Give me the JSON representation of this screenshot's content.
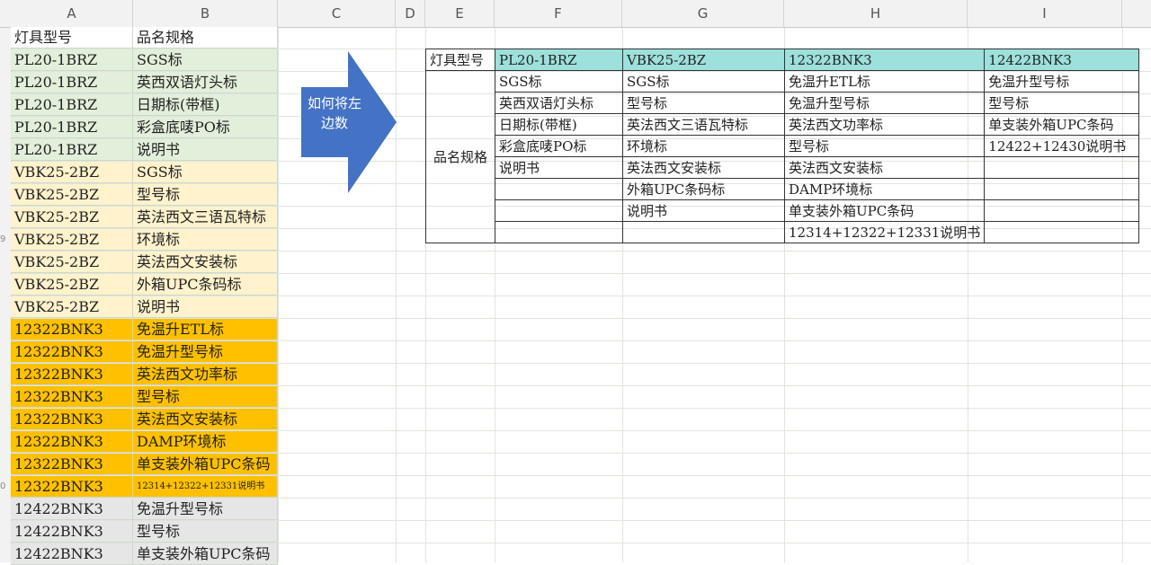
{
  "columns": [
    "A",
    "B",
    "C",
    "D",
    "E",
    "F",
    "G",
    "H",
    "I"
  ],
  "colors": {
    "green": "#e2efda",
    "yellow": "#fff2cc",
    "orange": "#ffc000",
    "gray": "#e7e6e6",
    "teal": "#9de0dc",
    "arrow": "#4472c4"
  },
  "left_header": {
    "model": "灯具型号",
    "spec": "品名规格"
  },
  "left_rows": [
    {
      "model": "PL20-1BRZ",
      "spec": "SGS标",
      "group": "green"
    },
    {
      "model": "PL20-1BRZ",
      "spec": "英西双语灯头标",
      "group": "green"
    },
    {
      "model": "PL20-1BRZ",
      "spec": "日期标(带框)",
      "group": "green"
    },
    {
      "model": "PL20-1BRZ",
      "spec": "彩盒底唛PO标",
      "group": "green"
    },
    {
      "model": "PL20-1BRZ",
      "spec": "说明书",
      "group": "green"
    },
    {
      "model": "VBK25-2BZ",
      "spec": "SGS标",
      "group": "yellow"
    },
    {
      "model": "VBK25-2BZ",
      "spec": "型号标",
      "group": "yellow"
    },
    {
      "model": "VBK25-2BZ",
      "spec": "英法西文三语瓦特标",
      "group": "yellow"
    },
    {
      "model": "VBK25-2BZ",
      "spec": "环境标",
      "group": "yellow"
    },
    {
      "model": "VBK25-2BZ",
      "spec": "英法西文安装标",
      "group": "yellow"
    },
    {
      "model": "VBK25-2BZ",
      "spec": "外箱UPC条码标",
      "group": "yellow"
    },
    {
      "model": "VBK25-2BZ",
      "spec": "说明书",
      "group": "yellow"
    },
    {
      "model": "12322BNK3",
      "spec": "免温升ETL标",
      "group": "orange"
    },
    {
      "model": "12322BNK3",
      "spec": "免温升型号标",
      "group": "orange"
    },
    {
      "model": "12322BNK3",
      "spec": "英法西文功率标",
      "group": "orange"
    },
    {
      "model": "12322BNK3",
      "spec": "型号标",
      "group": "orange"
    },
    {
      "model": "12322BNK3",
      "spec": "英法西文安装标",
      "group": "orange"
    },
    {
      "model": "12322BNK3",
      "spec": "DAMP环境标",
      "group": "orange"
    },
    {
      "model": "12322BNK3",
      "spec": "单支装外箱UPC条码",
      "group": "orange"
    },
    {
      "model": "12322BNK3",
      "spec": "12314+12322+12331说明书",
      "group": "orange",
      "small": true
    },
    {
      "model": "12422BNK3",
      "spec": "免温升型号标",
      "group": "gray"
    },
    {
      "model": "12422BNK3",
      "spec": "型号标",
      "group": "gray"
    },
    {
      "model": "12422BNK3",
      "spec": "单支装外箱UPC条码",
      "group": "gray"
    }
  ],
  "row_numbers": [
    "",
    "",
    "",
    "",
    "",
    "",
    "",
    "",
    "",
    "9",
    "",
    "",
    "",
    "",
    "",
    "",
    "",
    "",
    "",
    "",
    "0",
    "",
    "",
    ""
  ],
  "arrow_text": "如何将左边数",
  "result": {
    "model_label": "灯具型号",
    "spec_label": "品名规格",
    "models": [
      "PL20-1BRZ",
      "VBK25-2BZ",
      "12322BNK3",
      "12422BNK3"
    ],
    "specs": [
      [
        "SGS标",
        "SGS标",
        "免温升ETL标",
        "免温升型号标"
      ],
      [
        "英西双语灯头标",
        "型号标",
        "免温升型号标",
        "型号标"
      ],
      [
        "日期标(带框)",
        "英法西文三语瓦特标",
        "英法西文功率标",
        "单支装外箱UPC条码"
      ],
      [
        "彩盒底唛PO标",
        "环境标",
        "型号标",
        "12422+12430说明书"
      ],
      [
        "说明书",
        "英法西文安装标",
        "英法西文安装标",
        ""
      ],
      [
        "",
        "外箱UPC条码标",
        "DAMP环境标",
        ""
      ],
      [
        "",
        "说明书",
        "单支装外箱UPC条码",
        ""
      ],
      [
        "",
        "",
        "12314+12322+12331说明书",
        ""
      ]
    ]
  }
}
